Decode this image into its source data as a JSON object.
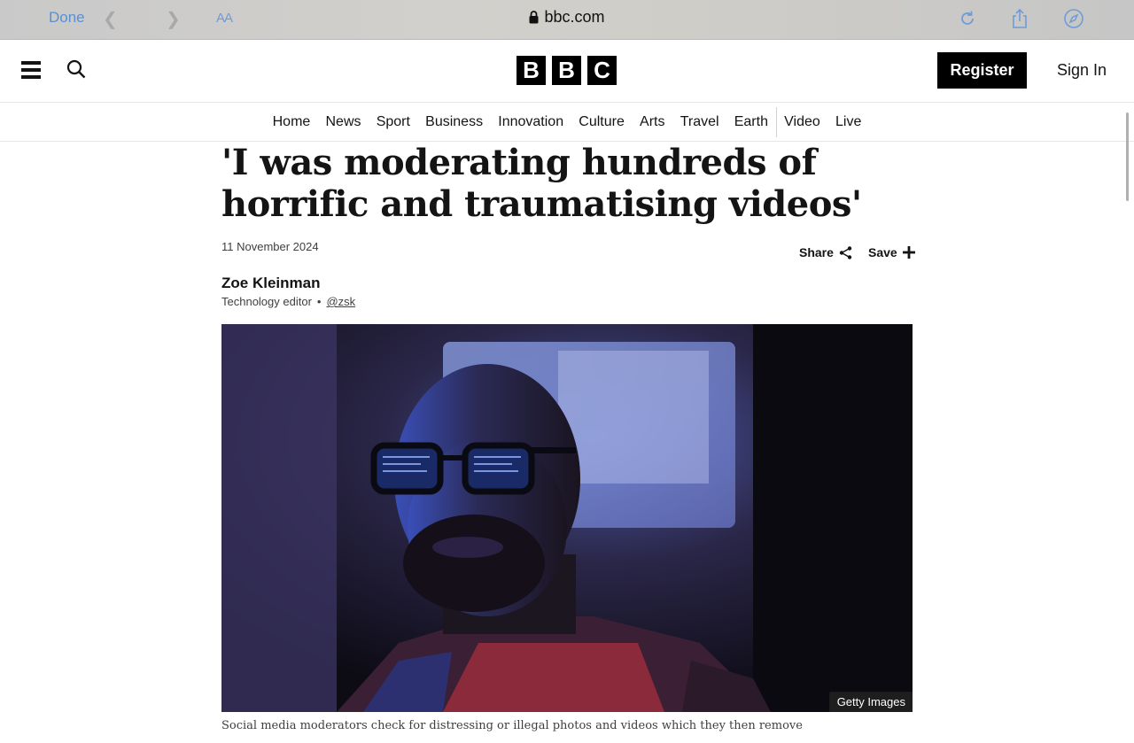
{
  "browser": {
    "done_label": "Done",
    "text_size_label": "AA",
    "url": "bbc.com"
  },
  "header": {
    "logo_letters": [
      "B",
      "B",
      "C"
    ],
    "register_label": "Register",
    "signin_label": "Sign In"
  },
  "nav": {
    "items": [
      "Home",
      "News",
      "Sport",
      "Business",
      "Innovation",
      "Culture",
      "Arts",
      "Travel",
      "Earth",
      "Video",
      "Live"
    ]
  },
  "article": {
    "headline": "'I was moderating hundreds of horrific and traumatising videos'",
    "date": "11 November 2024",
    "share_label": "Share",
    "save_label": "Save",
    "author_name": "Zoe Kleinman",
    "author_role": "Technology editor",
    "author_handle": "@zsk",
    "image_credit": "Getty Images",
    "image_caption": "Social media moderators check for distressing or illegal photos and videos which they then remove"
  },
  "colors": {
    "safari_accent": "#5a8fd4",
    "text_primary": "#141414",
    "register_bg": "#000000"
  }
}
